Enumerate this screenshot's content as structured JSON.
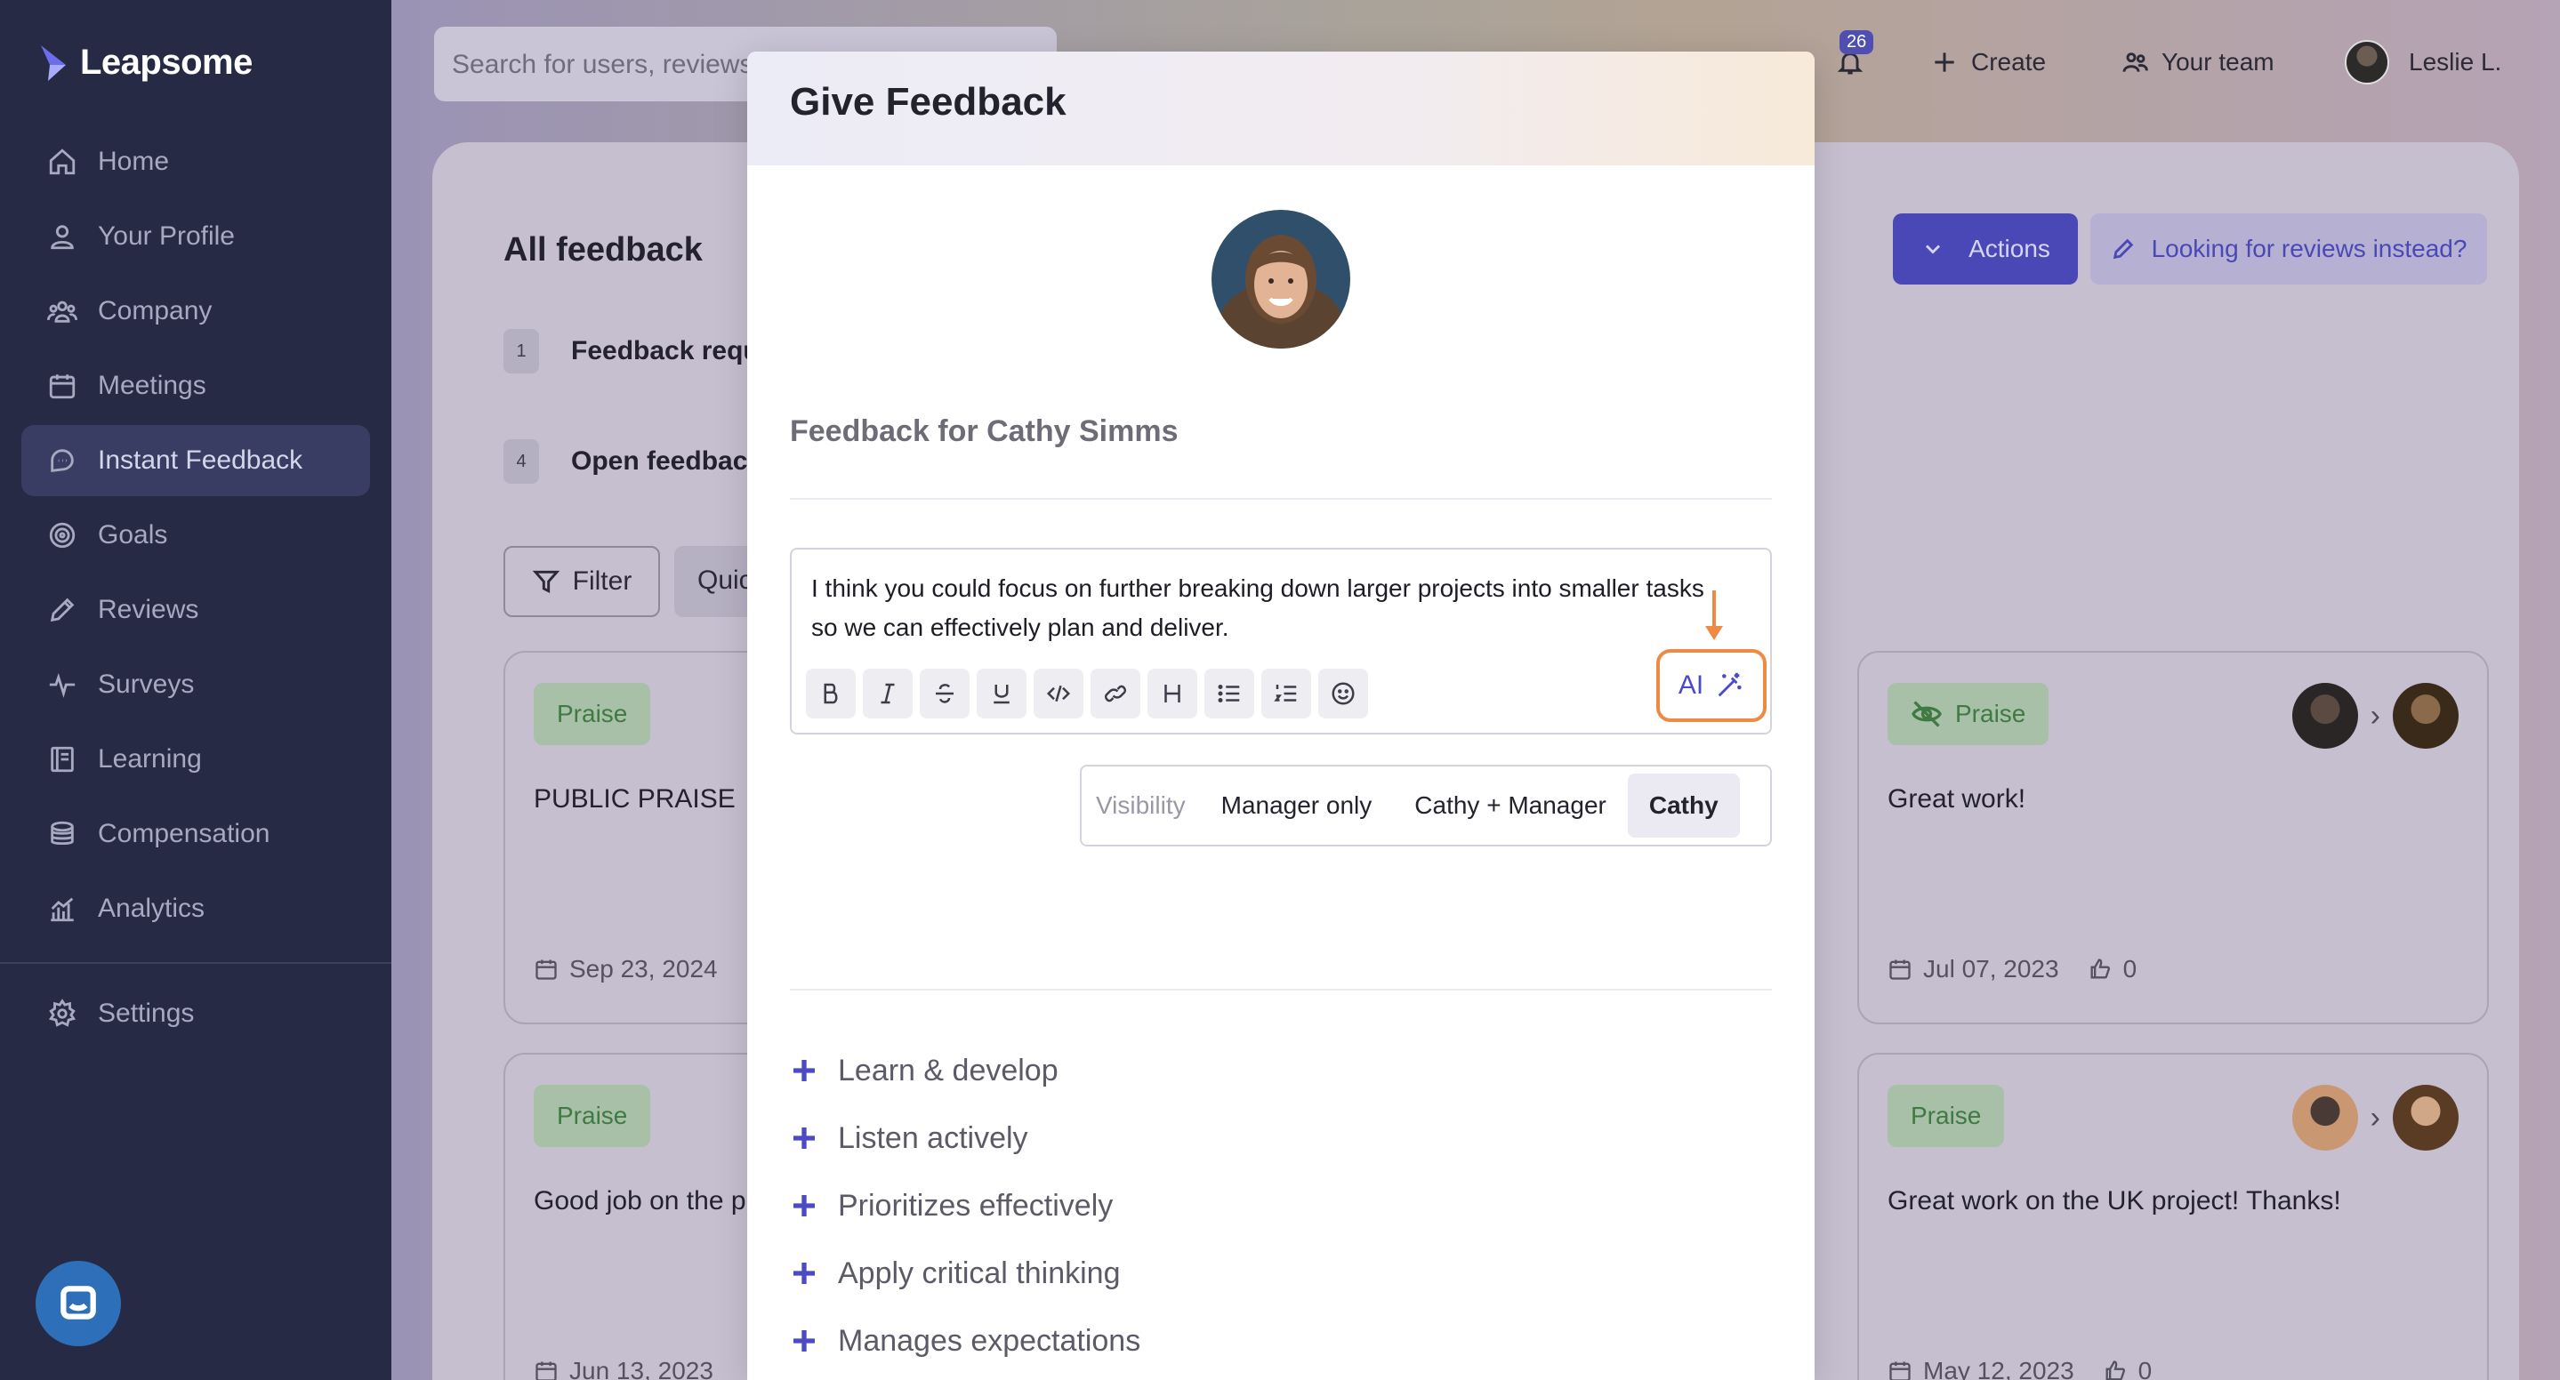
{
  "app": {
    "name": "Leapsome"
  },
  "sidebar": {
    "items": [
      {
        "label": "Home",
        "icon": "home-icon"
      },
      {
        "label": "Your Profile",
        "icon": "user-icon"
      },
      {
        "label": "Company",
        "icon": "people-icon"
      },
      {
        "label": "Meetings",
        "icon": "calendar-icon"
      },
      {
        "label": "Instant Feedback",
        "icon": "chat-icon",
        "active": true
      },
      {
        "label": "Goals",
        "icon": "target-icon"
      },
      {
        "label": "Reviews",
        "icon": "pencil-icon"
      },
      {
        "label": "Surveys",
        "icon": "pulse-icon"
      },
      {
        "label": "Learning",
        "icon": "book-icon"
      },
      {
        "label": "Compensation",
        "icon": "coins-icon"
      },
      {
        "label": "Analytics",
        "icon": "chart-icon"
      }
    ],
    "settings": {
      "label": "Settings",
      "icon": "gear-icon"
    }
  },
  "topbar": {
    "search_placeholder": "Search for users, reviews",
    "notifications_count": "26",
    "create_label": "Create",
    "team_label": "Your team",
    "user_label": "Leslie L."
  },
  "page": {
    "title": "All feedback",
    "requests": [
      {
        "count": "1",
        "label": "Feedback requ"
      },
      {
        "count": "4",
        "label": "Open feedbac"
      }
    ],
    "filter_label": "Filter",
    "quick_label": "Quic",
    "actions_label": "Actions",
    "reviews_link_label": "Looking for reviews instead?"
  },
  "cards": [
    {
      "tag": "Praise",
      "text": "PUBLIC PRAISE",
      "date": "Sep 23, 2024"
    },
    {
      "tag": "Praise",
      "text": "Great work!",
      "date": "Jul 07, 2023",
      "likes": "0"
    },
    {
      "tag": "Praise",
      "text": "Good job on the p",
      "date": "Jun 13, 2023"
    },
    {
      "tag": "Praise",
      "text": "Great work on the UK project! Thanks!",
      "date": "May 12, 2023",
      "likes": "0"
    }
  ],
  "modal": {
    "title": "Give Feedback",
    "feedback_for": "Feedback for Cathy Simms",
    "message": "I think you could focus on further breaking down larger projects into smaller tasks so we can effectively plan and deliver.",
    "toolbar_icons": [
      "bold-icon",
      "italic-icon",
      "strikethrough-icon",
      "underline-icon",
      "code-icon",
      "link-icon",
      "heading-icon",
      "bullet-list-icon",
      "numbered-list-icon",
      "emoji-icon"
    ],
    "ai_label": "AI",
    "visibility": {
      "label": "Visibility",
      "options": [
        "Manager only",
        "Cathy + Manager",
        "Cathy"
      ],
      "selected": "Cathy"
    },
    "skills": [
      "Learn & develop",
      "Listen actively",
      "Prioritizes effectively",
      "Apply critical thinking",
      "Manages expectations"
    ]
  },
  "colors": {
    "sidebar_bg": "#262a44",
    "accent": "#4c4ac6",
    "highlight": "#ef8a44",
    "praise": "#3f7a43"
  }
}
